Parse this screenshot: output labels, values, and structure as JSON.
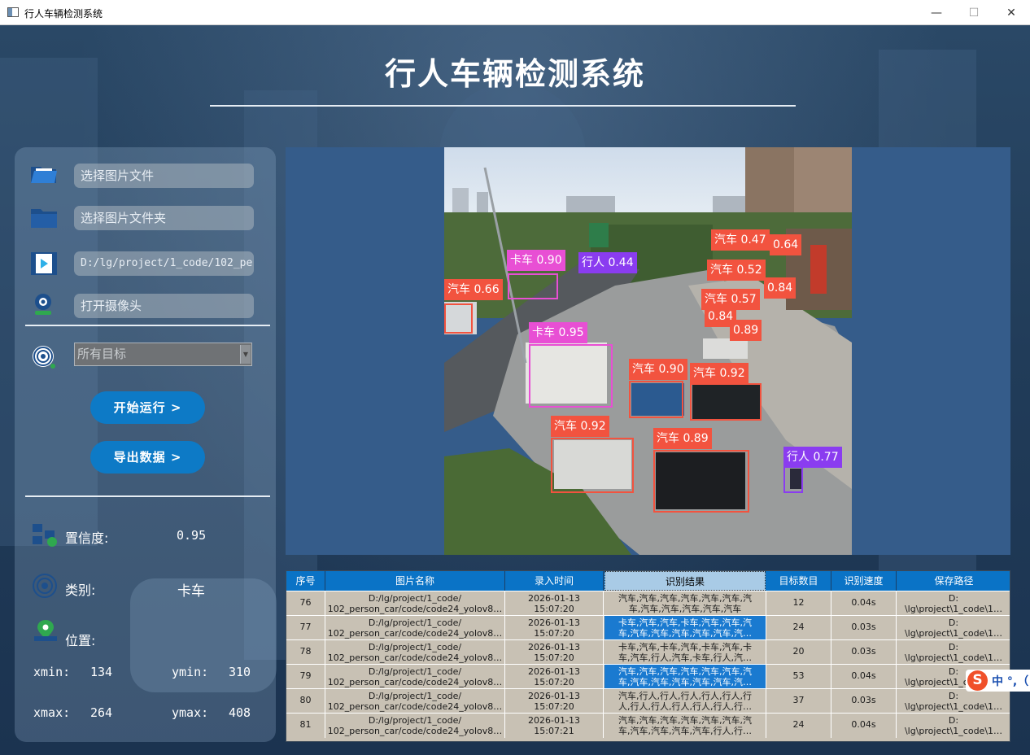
{
  "window": {
    "title": "行人车辆检测系统",
    "minimize": "—",
    "maximize": "☐",
    "close": "✕"
  },
  "header": {
    "title": "行人车辆检测系统"
  },
  "sidebar": {
    "image_file_placeholder": "选择图片文件",
    "image_folder_placeholder": "选择图片文件夹",
    "video_path_value": "D:/lg/project/1_code/102_pe",
    "camera_placeholder": "打开摄像头",
    "target_select_value": "所有目标",
    "start_button": "开始运行 >",
    "export_button": "导出数据 >",
    "confidence_label": "置信度:",
    "confidence_value": "0.95",
    "class_label": "类别:",
    "class_value": "卡车",
    "position_label": "位置:",
    "xmin_label": "xmin:",
    "xmin_value": "134",
    "ymin_label": "ymin:",
    "ymin_value": "310",
    "xmax_label": "xmax:",
    "xmax_value": "264",
    "ymax_label": "ymax:",
    "ymax_value": "408"
  },
  "detections": [
    {
      "label": "汽车 0.47",
      "class": "car"
    },
    {
      "label": "0.64",
      "class": "car"
    },
    {
      "label": "卡车 0.90",
      "class": "truck"
    },
    {
      "label": "行人 0.44",
      "class": "person"
    },
    {
      "label": "汽车 0.52",
      "class": "car"
    },
    {
      "label": "汽车 0.66",
      "class": "car"
    },
    {
      "label": "0.84",
      "class": "car"
    },
    {
      "label": "汽车 0.57",
      "class": "car"
    },
    {
      "label": "0.84",
      "class": "car"
    },
    {
      "label": "0.89",
      "class": "car"
    },
    {
      "label": "卡车 0.95",
      "class": "truck"
    },
    {
      "label": "汽车 0.90",
      "class": "car"
    },
    {
      "label": "汽车 0.92",
      "class": "car"
    },
    {
      "label": "汽车 0.92",
      "class": "car"
    },
    {
      "label": "汽车 0.89",
      "class": "car"
    },
    {
      "label": "行人 0.77",
      "class": "person"
    }
  ],
  "class_colors": {
    "car": "#f2533f",
    "truck": "#e84fd4",
    "person": "#8a3cf0"
  },
  "table": {
    "headers": [
      "序号",
      "图片名称",
      "录入时间",
      "识别结果",
      "目标数目",
      "识别速度",
      "保存路径"
    ],
    "rows": [
      {
        "id": "76",
        "name1": "D:/lg/project/1_code/",
        "name2": "102_person_car/code/code24_yolov8…",
        "time1": "2026-01-13",
        "time2": "15:07:20",
        "res1": "汽车,汽车,汽车,汽车,汽车,汽车,汽",
        "res2": "车,汽车,汽车,汽车,汽车,汽车",
        "count": "12",
        "speed": "0.04s",
        "path1": "D:",
        "path2": "\\lg\\project\\1_code\\1…"
      },
      {
        "id": "77",
        "name1": "D:/lg/project/1_code/",
        "name2": "102_person_car/code/code24_yolov8…",
        "time1": "2026-01-13",
        "time2": "15:07:20",
        "res1": "卡车,汽车,汽车,卡车,汽车,汽车,汽",
        "res2": "车,汽车,汽车,汽车,汽车,汽车,汽…",
        "count": "24",
        "speed": "0.03s",
        "path1": "D:",
        "path2": "\\lg\\project\\1_code\\1…"
      },
      {
        "id": "78",
        "name1": "D:/lg/project/1_code/",
        "name2": "102_person_car/code/code24_yolov8…",
        "time1": "2026-01-13",
        "time2": "15:07:20",
        "res1": "卡车,汽车,卡车,汽车,卡车,汽车,卡",
        "res2": "车,汽车,行人,汽车,卡车,行人,汽…",
        "count": "20",
        "speed": "0.03s",
        "path1": "D:",
        "path2": "\\lg\\project\\1_code\\1…"
      },
      {
        "id": "79",
        "name1": "D:/lg/project/1_code/",
        "name2": "102_person_car/code/code24_yolov8…",
        "time1": "2026-01-13",
        "time2": "15:07:20",
        "res1": "汽车,汽车,汽车,汽车,汽车,汽车,汽",
        "res2": "车,汽车,汽车,汽车,汽车,汽车,汽…",
        "count": "53",
        "speed": "0.04s",
        "path1": "D:",
        "path2": "\\lg\\project\\1_code\\1…"
      },
      {
        "id": "80",
        "name1": "D:/lg/project/1_code/",
        "name2": "102_person_car/code/code24_yolov8…",
        "time1": "2026-01-13",
        "time2": "15:07:20",
        "res1": "汽车,行人,行人,行人,行人,行人,行",
        "res2": "人,行人,行人,行人,行人,行人,行…",
        "count": "37",
        "speed": "0.03s",
        "path1": "D:",
        "path2": "\\lg\\project\\1_code\\1…"
      },
      {
        "id": "81",
        "name1": "D:/lg/project/1_code/",
        "name2": "102_person_car/code/code24_yolov8…",
        "time1": "2026-01-13",
        "time2": "15:07:21",
        "res1": "汽车,汽车,汽车,汽车,汽车,汽车,汽",
        "res2": "车,汽车,汽车,汽车,汽车,行人,行…",
        "count": "24",
        "speed": "0.04s",
        "path1": "D:",
        "path2": "\\lg\\project\\1_code\\1…"
      }
    ],
    "selected_rows": [
      "77",
      "79"
    ]
  },
  "ime": {
    "logo": "S",
    "text": "中 °,（"
  }
}
